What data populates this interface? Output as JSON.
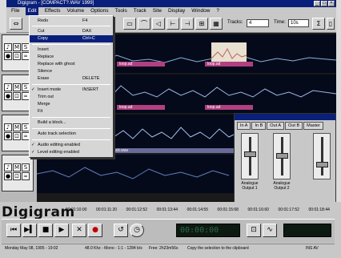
{
  "window": {
    "title": "Digigram - [COMPACT?.WAV 1999]",
    "controls": [
      "_",
      "□",
      "×"
    ]
  },
  "menubar": {
    "items": [
      "File",
      "Edit",
      "Effects",
      "Volume",
      "Options",
      "Tools",
      "Track",
      "Site",
      "Display",
      "Window",
      "?"
    ]
  },
  "toolbar": {
    "track_label": "Tracks:",
    "track_value": "4",
    "time_label": "Time:",
    "time_value": "10s"
  },
  "edit_menu": {
    "items": [
      {
        "label": "Redo",
        "shortcut": "F4"
      },
      {
        "label": "Cut",
        "shortcut": "DAX"
      },
      {
        "label": "Copy",
        "shortcut": "Ctrl+C",
        "selected": true
      },
      {
        "label": "Insert",
        "shortcut": ""
      },
      {
        "label": "Replace",
        "shortcut": ""
      },
      {
        "label": "Replace with ghost",
        "shortcut": ""
      },
      {
        "label": "Silence",
        "shortcut": ""
      },
      {
        "label": "Erase",
        "shortcut": "DELETE"
      },
      {
        "label": "Insert mode",
        "shortcut": "INSERT",
        "checked": true
      },
      {
        "label": "Trim out",
        "shortcut": ""
      },
      {
        "label": "Merge",
        "shortcut": ""
      },
      {
        "label": "Fit",
        "shortcut": ""
      },
      {
        "label": "Build a block...",
        "shortcut": ""
      },
      {
        "label": "Auto track selection",
        "shortcut": ""
      },
      {
        "label": "Audio editing enabled",
        "shortcut": "",
        "checked": true
      },
      {
        "label": "Level editing enabled",
        "shortcut": "",
        "checked": true
      }
    ]
  },
  "tracks": [
    {
      "clips": [
        "loop.ad",
        "loop.ad"
      ]
    },
    {
      "clips": [
        "loop.ad",
        "loop.ad"
      ]
    },
    {
      "clips": [
        "track.wav"
      ]
    },
    {
      "clips": []
    }
  ],
  "mixer": {
    "tabs": [
      "In A",
      "In B",
      "Out A",
      "Out B",
      "Master"
    ],
    "outputs": [
      "Analogue Output 1",
      "Analogue Output 2"
    ],
    "levels": [
      0.6,
      0.55,
      0.3
    ]
  },
  "brand": {
    "logo": "Digigram"
  },
  "timeline": {
    "ticks": [
      "00:01:10:00",
      "00:01:11:20",
      "00:01:12:52",
      "00:01:13:44",
      "00:01:14:55",
      "00:01:15:68",
      "00:01:16:60",
      "00:01:17:52",
      "00:01:18:44"
    ]
  },
  "transport": {
    "buttons": [
      "rewind-start",
      "play-pause",
      "stop",
      "play",
      "loop-x",
      "record",
      "loop",
      "clock"
    ],
    "counter": "00:00:00"
  },
  "status": {
    "date": "Monday May 08, 1995 - 19:02",
    "format": "48.0 Khz - Mono - 1:1 - 1284 b/s",
    "free": "Free: 2h23m56s",
    "hint": "Copy the selection to the clipboard",
    "mode": "INS   AV"
  }
}
